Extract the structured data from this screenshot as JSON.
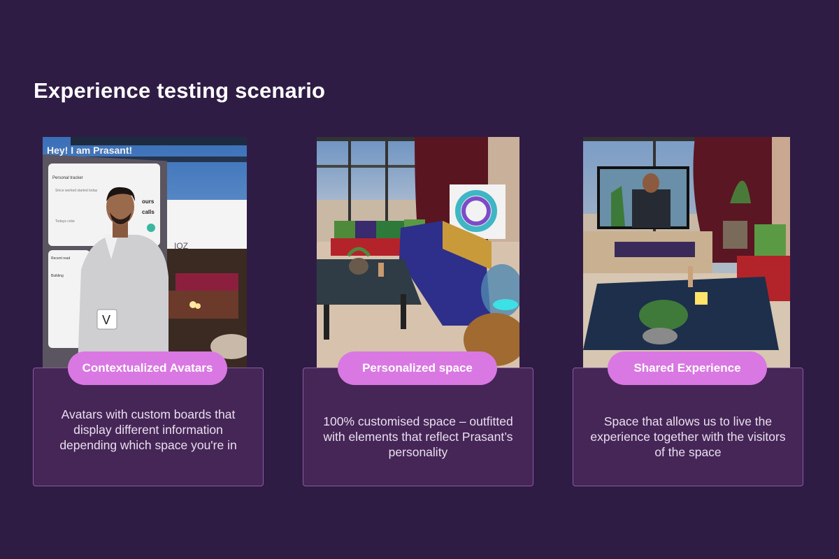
{
  "slide": {
    "title": "Experience testing scenario"
  },
  "cards": [
    {
      "label": "Contextualized Avatars",
      "description": "Avatars with custom boards that display different information depending which space you're in",
      "scene": {
        "board_title": "Hey! I am Prasant!",
        "board_section_1": "Personal tracker",
        "board_line_1": "Since worked started today",
        "board_line_2": "Todays color",
        "board_frag_1": "ours",
        "board_frag_2": "calls",
        "board_section_2": "Recent read",
        "board_item": "Building",
        "badge_letter": "V",
        "wall_text": "IOZ"
      }
    },
    {
      "label": "Personalized space",
      "description": "100% customised space – outfitted with elements that reflect Prasant’s personality"
    },
    {
      "label": "Shared Experience",
      "description": "Space that allows us to live the experience together with the visitors of the space"
    }
  ],
  "colors": {
    "background": "#2f1c44",
    "card_fill": "#452656",
    "card_border": "#8a5aa5",
    "pill": "#d978e2"
  }
}
